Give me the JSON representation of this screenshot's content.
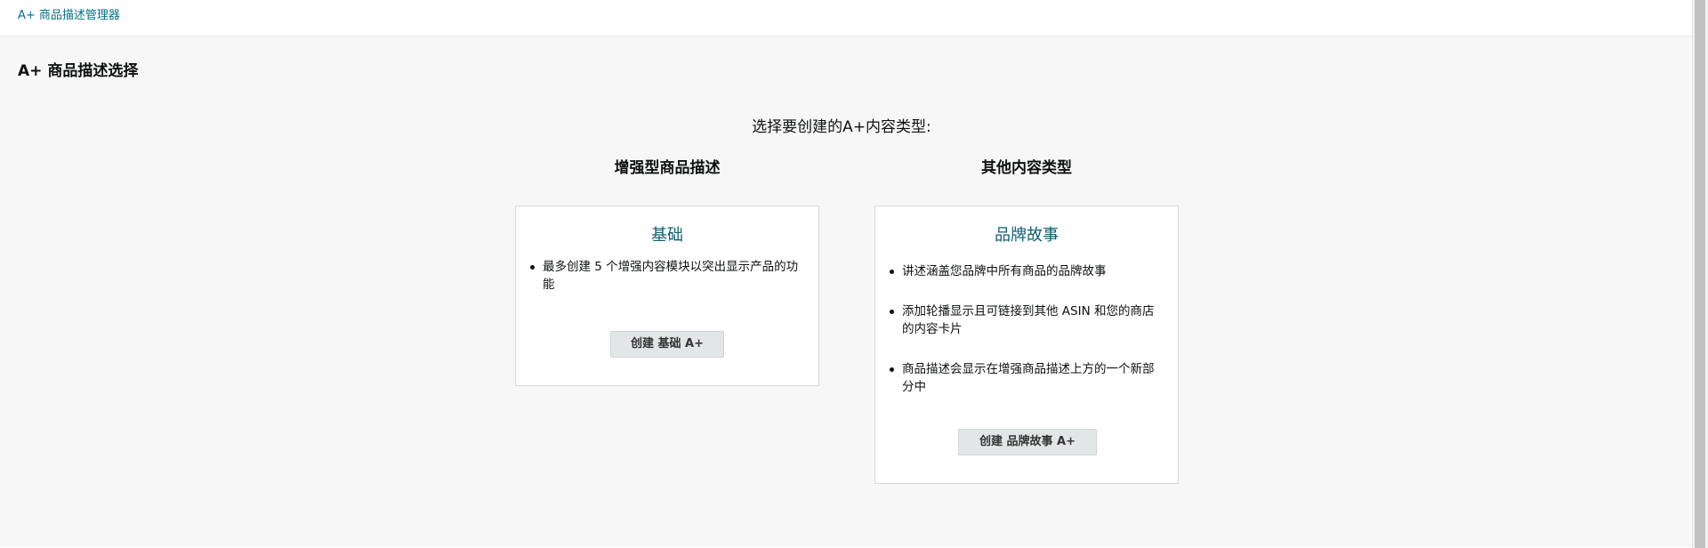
{
  "breadcrumb": {
    "label": "A+ 商品描述管理器"
  },
  "page": {
    "title": "A+ 商品描述选择",
    "prompt": "选择要创建的A+内容类型:"
  },
  "columns": {
    "enhanced": {
      "heading": "增强型商品描述",
      "card": {
        "title": "基础",
        "bullets": [
          "最多创建 5 个增强内容模块以突出显示产品的功能"
        ],
        "button_label": "创建 基础 A+"
      }
    },
    "other": {
      "heading": "其他内容类型",
      "card": {
        "title": "品牌故事",
        "bullets": [
          "讲述涵盖您品牌中所有商品的品牌故事",
          "添加轮播显示且可链接到其他 ASIN 和您的商店的内容卡片",
          "商品描述会显示在增强商品描述上方的一个新部分中"
        ],
        "button_label": "创建 品牌故事 A+"
      }
    }
  },
  "colors": {
    "link": "#007185",
    "card_title": "#0f5f6f",
    "background": "#f7f7f7",
    "button": "#e3e6e6"
  }
}
